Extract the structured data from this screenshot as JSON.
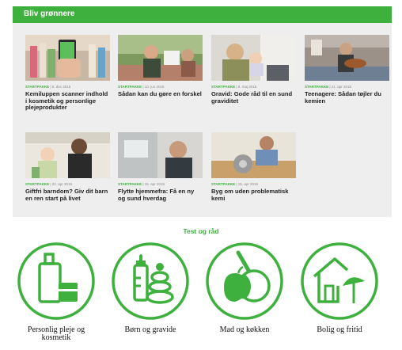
{
  "section_header": {
    "title": "Bliv grønnere"
  },
  "articles": [
    {
      "tag": "STARTPAKKE",
      "date": "8. dec 2015",
      "title": "Kemiluppen scanner indhold i kosmetik og personlige plejeprodukter"
    },
    {
      "tag": "STARTPAKKE",
      "date": "10. jun 2015",
      "title": "Sådan kan du gøre en forskel"
    },
    {
      "tag": "STARTPAKKE",
      "date": "8. maj 2015",
      "title": "Gravid: Gode råd til en sund graviditet"
    },
    {
      "tag": "STARTPAKKE",
      "date": "21. apr 2015",
      "title": "Teenagere: Sådan tøjler du kemien"
    },
    {
      "tag": "STARTPAKKE",
      "date": "22. apr 2015",
      "title": "Giftfri barndom? Giv dit barn en ren start på livet"
    },
    {
      "tag": "STARTPAKKE",
      "date": "15. apr 2015",
      "title": "Flytte hjemmefra: Få en ny og sund hverdag"
    },
    {
      "tag": "STARTPAKKE",
      "date": "15. apr 2015",
      "title": "Byg om uden problematisk kemi"
    }
  ],
  "test_section": {
    "title": "Test og råd",
    "categories": [
      {
        "label": "Personlig pleje og kosmetik",
        "icon": "cosmetics-bottle-icon"
      },
      {
        "label": "Børn og gravide",
        "icon": "baby-bottle-stacking-rings-icon"
      },
      {
        "label": "Mad og køkken",
        "icon": "apple-pan-icon"
      },
      {
        "label": "Bolig og fritid",
        "icon": "house-umbrella-icon"
      }
    ]
  },
  "colors": {
    "accent": "#3db03d",
    "panel_background": "#eeeeee"
  }
}
